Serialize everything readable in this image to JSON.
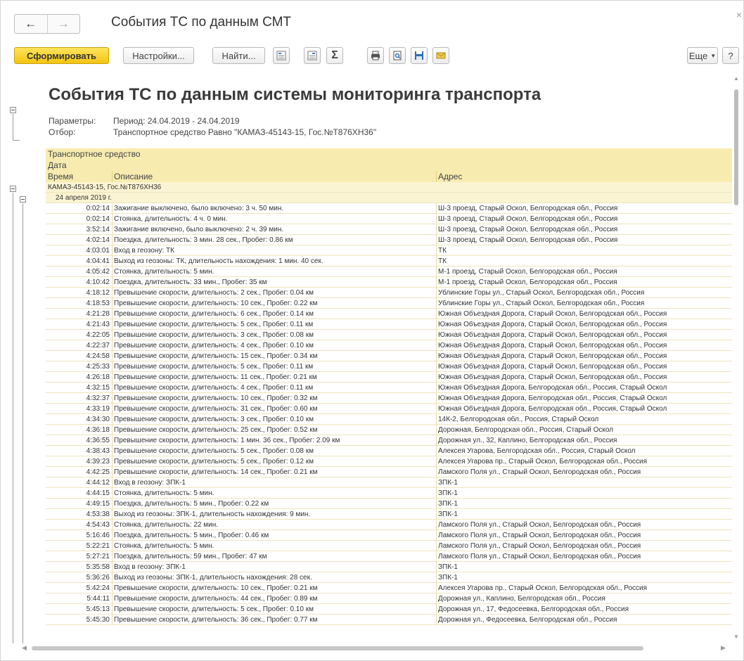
{
  "window": {
    "title": "События ТС по данным СМТ",
    "back": "←",
    "forward": "→",
    "close": "×"
  },
  "toolbar": {
    "generate": "Сформировать",
    "settings": "Настройки...",
    "find": "Найти...",
    "sum": "Σ",
    "more": "Еще",
    "help": "?"
  },
  "report": {
    "title": "События ТС по данным системы мониторинга транспорта",
    "params_label": "Параметры:",
    "params_value": "Период: 24.04.2019 - 24.04.2019",
    "filter_label": "Отбор:",
    "filter_value": "Транспортное средство Равно \"КАМАЗ-45143-15, Гос.№Т876ХН36\"",
    "header": {
      "vehicle": "Транспортное средство",
      "date": "Дата",
      "time": "Время",
      "description": "Описание",
      "address": "Адрес"
    },
    "vehicle_group": "КАМАЗ-45143-15, Гос.№Т876ХН36",
    "date_group": "24 апреля 2019 г.",
    "rows": [
      {
        "time": "0:02:14",
        "desc": "Зажигание выключено, было включено: 3 ч. 50 мин.",
        "addr": "Ш-3 проезд, Старый Оскол, Белгородская обл., Россия"
      },
      {
        "time": "0:02:14",
        "desc": "Стоянка, длительность: 4 ч. 0 мин.",
        "addr": "Ш-3 проезд, Старый Оскол, Белгородская обл., Россия"
      },
      {
        "time": "3:52:14",
        "desc": "Зажигание включено, было выключено: 2 ч. 39 мин.",
        "addr": "Ш-3 проезд, Старый Оскол, Белгородская обл., Россия"
      },
      {
        "time": "4:02:14",
        "desc": "Поездка, длительность: 3 мин. 28 сек., Пробег: 0.86 км",
        "addr": "Ш-3 проезд, Старый Оскол, Белгородская обл., Россия"
      },
      {
        "time": "4:03:01",
        "desc": "Вход в геозону: ТК",
        "addr": "ТК"
      },
      {
        "time": "4:04:41",
        "desc": "Выход из геозоны: ТК, длительность нахождения: 1 мин. 40 сек.",
        "addr": "ТК"
      },
      {
        "time": "4:05:42",
        "desc": "Стоянка, длительность: 5 мин.",
        "addr": "М-1 проезд, Старый Оскол, Белгородская обл., Россия"
      },
      {
        "time": "4:10:42",
        "desc": "Поездка, длительность: 33 мин., Пробег: 35 км",
        "addr": "М-1 проезд, Старый Оскол, Белгородская обл., Россия"
      },
      {
        "time": "4:18:12",
        "desc": "Превышение скорости, длительность: 2 сек., Пробег: 0.04 км",
        "addr": "Ублинские Горы ул., Старый Оскол, Белгородская обл., Россия"
      },
      {
        "time": "4:18:53",
        "desc": "Превышение скорости, длительность: 10 сек., Пробег: 0.22 км",
        "addr": "Ублинские Горы ул., Старый Оскол, Белгородская обл., Россия"
      },
      {
        "time": "4:21:28",
        "desc": "Превышение скорости, длительность: 6 сек., Пробег: 0.14 км",
        "addr": "Южная Объездная Дорога, Старый Оскол, Белгородская обл., Россия"
      },
      {
        "time": "4:21:43",
        "desc": "Превышение скорости, длительность: 5 сек., Пробег: 0.11 км",
        "addr": "Южная Объездная Дорога, Старый Оскол, Белгородская обл., Россия"
      },
      {
        "time": "4:22:05",
        "desc": "Превышение скорости, длительность: 3 сек., Пробег: 0.08 км",
        "addr": "Южная Объездная Дорога, Старый Оскол, Белгородская обл., Россия"
      },
      {
        "time": "4:22:37",
        "desc": "Превышение скорости, длительность: 4 сек., Пробег: 0.10 км",
        "addr": "Южная Объездная Дорога, Старый Оскол, Белгородская обл., Россия"
      },
      {
        "time": "4:24:58",
        "desc": "Превышение скорости, длительность: 15 сек., Пробег: 0.34 км",
        "addr": "Южная Объездная Дорога, Старый Оскол, Белгородская обл., Россия"
      },
      {
        "time": "4:25:33",
        "desc": "Превышение скорости, длительность: 5 сек., Пробег: 0.11 км",
        "addr": "Южная Объездная Дорога, Старый Оскол, Белгородская обл., Россия"
      },
      {
        "time": "4:26:18",
        "desc": "Превышение скорости, длительность: 11 сек., Пробег: 0.21 км",
        "addr": "Южная Объездная Дорога, Старый Оскол, Белгородская обл., Россия"
      },
      {
        "time": "4:32:15",
        "desc": "Превышение скорости, длительность: 4 сек., Пробег: 0.11 км",
        "addr": "Южная Объездная Дорога, Белгородская обл., Россия, Старый Оскол"
      },
      {
        "time": "4:32:37",
        "desc": "Превышение скорости, длительность: 10 сек., Пробег: 0.32 км",
        "addr": "Южная Объездная Дорога, Белгородская обл., Россия, Старый Оскол"
      },
      {
        "time": "4:33:19",
        "desc": "Превышение скорости, длительность: 31 сек., Пробег: 0.60 км",
        "addr": "Южная Объездная Дорога, Белгородская обл., Россия, Старый Оскол"
      },
      {
        "time": "4:34:30",
        "desc": "Превышение скорости, длительность: 3 сек., Пробег: 0.10 км",
        "addr": "14К-2, Белгородская обл., Россия, Старый Оскол"
      },
      {
        "time": "4:36:18",
        "desc": "Превышение скорости, длительность: 25 сек., Пробег: 0.52 км",
        "addr": "Дорожная, Белгородская обл., Россия, Старый Оскол"
      },
      {
        "time": "4:36:55",
        "desc": "Превышение скорости, длительность: 1 мин. 36 сек., Пробег: 2.09 км",
        "addr": "Дорожная ул., 32, Каплино, Белгородская обл., Россия"
      },
      {
        "time": "4:38:43",
        "desc": "Превышение скорости, длительность: 5 сек., Пробег: 0.08 км",
        "addr": "Алексея Угарова, Белгородская обл., Россия, Старый Оскол"
      },
      {
        "time": "4:39:23",
        "desc": "Превышение скорости, длительность: 5 сек., Пробег: 0.12 км",
        "addr": "Алексея Угарова пр., Старый Оскол, Белгородская обл., Россия"
      },
      {
        "time": "4:42:25",
        "desc": "Превышение скорости, длительность: 14 сек., Пробег: 0.21 км",
        "addr": "Ламского Поля ул., Старый Оскол, Белгородская обл., Россия"
      },
      {
        "time": "4:44:12",
        "desc": "Вход в геозону: ЗПК-1",
        "addr": "ЗПК-1"
      },
      {
        "time": "4:44:15",
        "desc": "Стоянка, длительность: 5 мин.",
        "addr": "ЗПК-1"
      },
      {
        "time": "4:49:15",
        "desc": "Поездка, длительность: 5 мин., Пробег: 0.22 км",
        "addr": "ЗПК-1"
      },
      {
        "time": "4:53:38",
        "desc": "Выход из геозоны: ЗПК-1, длительность нахождения: 9 мин.",
        "addr": "ЗПК-1"
      },
      {
        "time": "4:54:43",
        "desc": "Стоянка, длительность: 22 мин.",
        "addr": "Ламского Поля ул., Старый Оскол, Белгородская обл., Россия"
      },
      {
        "time": "5:16:46",
        "desc": "Поездка, длительность: 5 мин., Пробег: 0.46 км",
        "addr": "Ламского Поля ул., Старый Оскол, Белгородская обл., Россия"
      },
      {
        "time": "5:22:21",
        "desc": "Стоянка, длительность: 5 мин.",
        "addr": "Ламского Поля ул., Старый Оскол, Белгородская обл., Россия"
      },
      {
        "time": "5:27:21",
        "desc": "Поездка, длительность: 59 мин., Пробег: 47 км",
        "addr": "Ламского Поля ул., Старый Оскол, Белгородская обл., Россия"
      },
      {
        "time": "5:35:58",
        "desc": "Вход в геозону: ЗПК-1",
        "addr": "ЗПК-1"
      },
      {
        "time": "5:36:26",
        "desc": "Выход из геозоны: ЗПК-1, длительность нахождения: 28 сек.",
        "addr": "ЗПК-1"
      },
      {
        "time": "5:42:24",
        "desc": "Превышение скорости, длительность: 10 сек., Пробег: 0.21 км",
        "addr": "Алексея Угарова пр., Старый Оскол, Белгородская обл., Россия"
      },
      {
        "time": "5:44:11",
        "desc": "Превышение скорости, длительность: 44 сек., Пробег: 0.89 км",
        "addr": "Дорожная ул., Каплино, Белгородская обл., Россия"
      },
      {
        "time": "5:45:13",
        "desc": "Превышение скорости, длительность: 5 сек., Пробег: 0.10 км",
        "addr": "Дорожная ул., 17, Федосеевка, Белгородская обл., Россия"
      },
      {
        "time": "5:45:30",
        "desc": "Превышение скорости, длительность: 36 сек., Пробег: 0.77 км",
        "addr": "Дорожная ул., Федосеевка, Белгородская обл., Россия"
      }
    ]
  }
}
